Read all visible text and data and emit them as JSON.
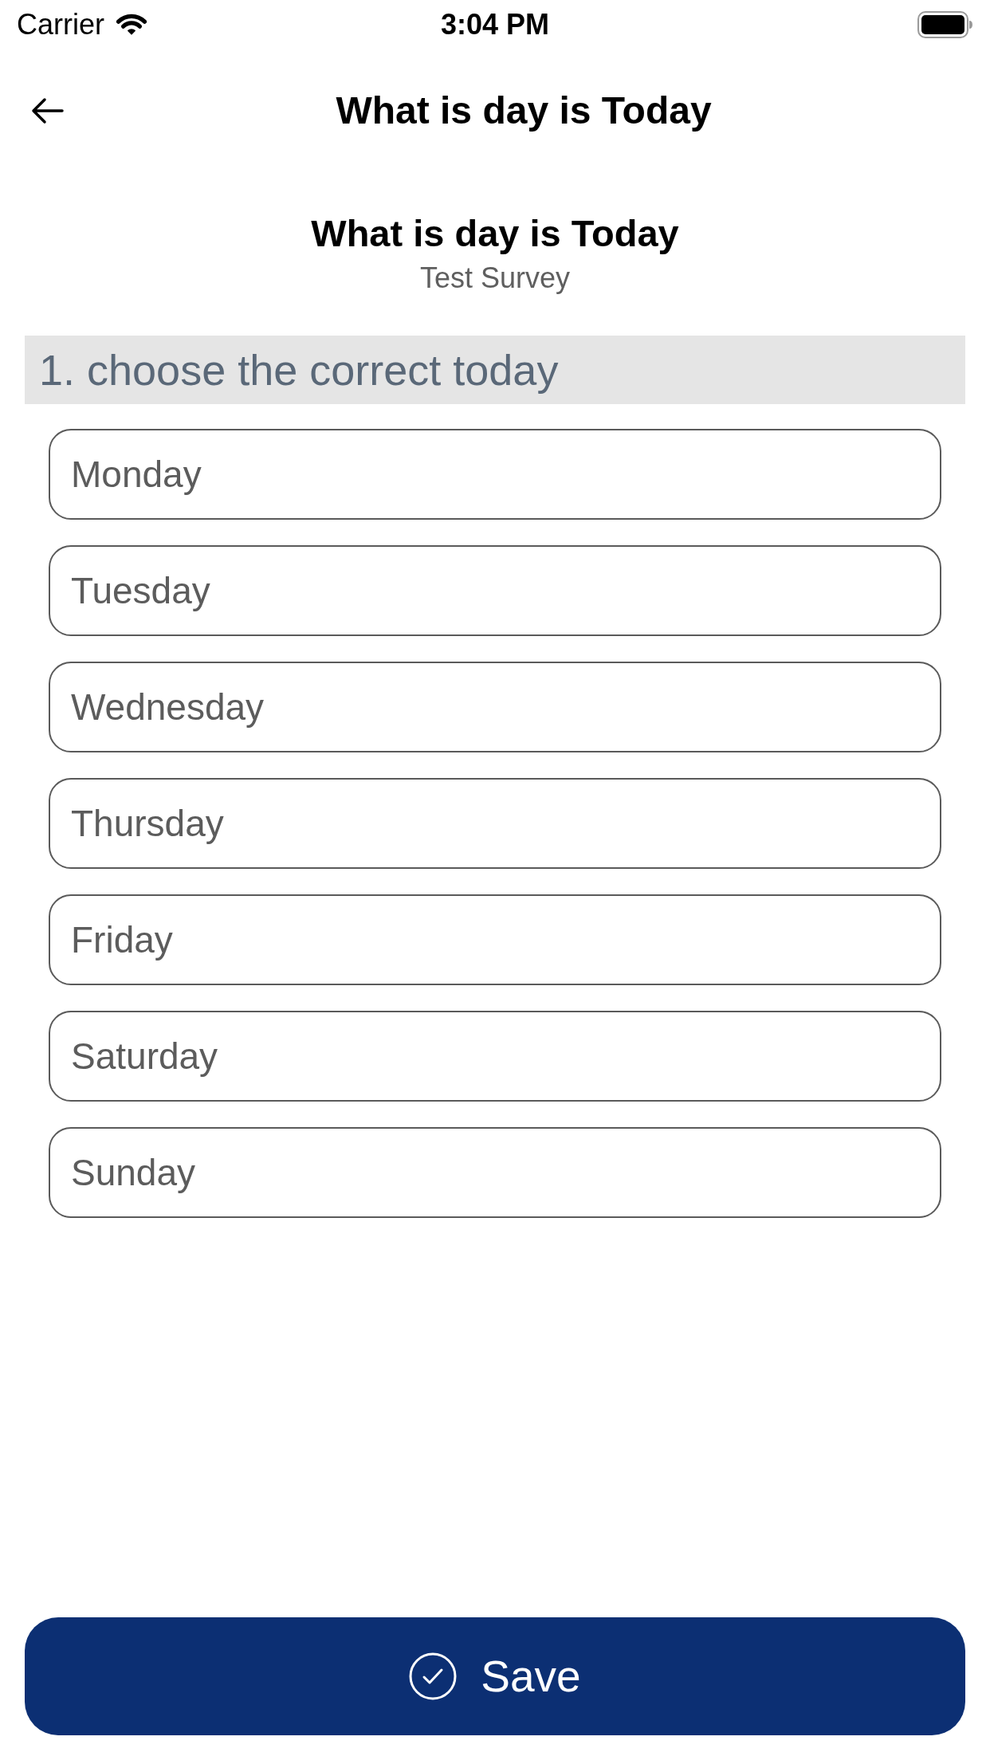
{
  "status_bar": {
    "carrier": "Carrier",
    "time": "3:04 PM"
  },
  "nav_bar": {
    "title": "What is day is Today"
  },
  "survey": {
    "title": "What is day is Today",
    "subtitle": "Test Survey"
  },
  "questions": [
    {
      "label": "1. choose the correct today",
      "options": [
        {
          "label": "Monday",
          "selected": false
        },
        {
          "label": "Tuesday",
          "selected": false
        },
        {
          "label": "Wednesday",
          "selected": false
        },
        {
          "label": "Thursday",
          "selected": false
        },
        {
          "label": "Friday",
          "selected": false
        },
        {
          "label": "Saturday",
          "selected": false
        },
        {
          "label": "Sunday",
          "selected": false
        }
      ]
    }
  ],
  "save_button": {
    "label": "Save"
  }
}
